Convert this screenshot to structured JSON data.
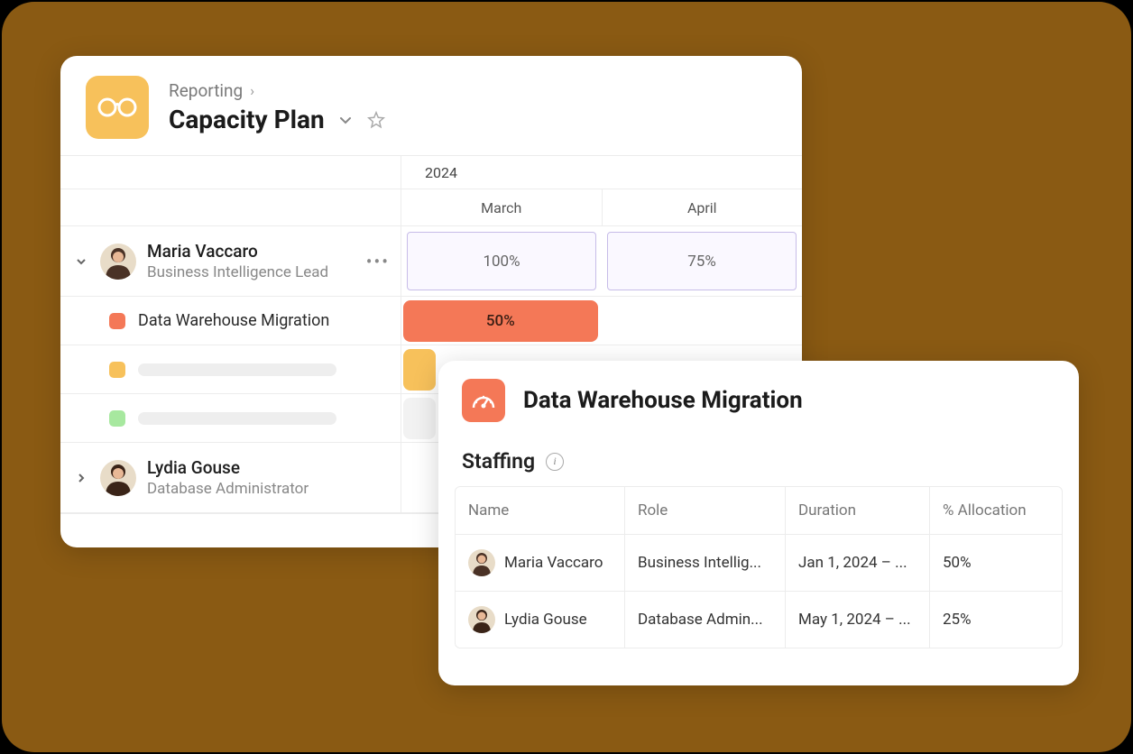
{
  "header": {
    "breadcrumb": "Reporting",
    "title": "Capacity Plan"
  },
  "timeline": {
    "year": "2024",
    "months": [
      "March",
      "April"
    ]
  },
  "people": [
    {
      "name": "Maria Vaccaro",
      "role": "Business Intelligence Lead",
      "expanded": true,
      "allocations": [
        "100%",
        "75%"
      ],
      "tasks": [
        {
          "label": "Data Warehouse Migration",
          "color": "orange",
          "bar_label": "50%"
        },
        {
          "label": "",
          "color": "yellow",
          "bar_label": ""
        },
        {
          "label": "",
          "color": "green",
          "bar_label": ""
        }
      ]
    },
    {
      "name": "Lydia Gouse",
      "role": "Database Administrator",
      "expanded": false
    }
  ],
  "detail": {
    "title": "Data Warehouse Migration",
    "section": "Staffing",
    "columns": [
      "Name",
      "Role",
      "Duration",
      "% Allocation"
    ],
    "rows": [
      {
        "name": "Maria Vaccaro",
        "role": "Business Intellig...",
        "duration": "Jan 1, 2024 – ...",
        "allocation": "50%"
      },
      {
        "name": "Lydia Gouse",
        "role": "Database Admin...",
        "duration": "May 1, 2024 – ...",
        "allocation": "25%"
      }
    ]
  },
  "colors": {
    "brand_yellow": "#f7c15b",
    "brand_orange": "#f47857",
    "brand_green": "#a7e89f",
    "bg_brown": "#8a5a13"
  }
}
